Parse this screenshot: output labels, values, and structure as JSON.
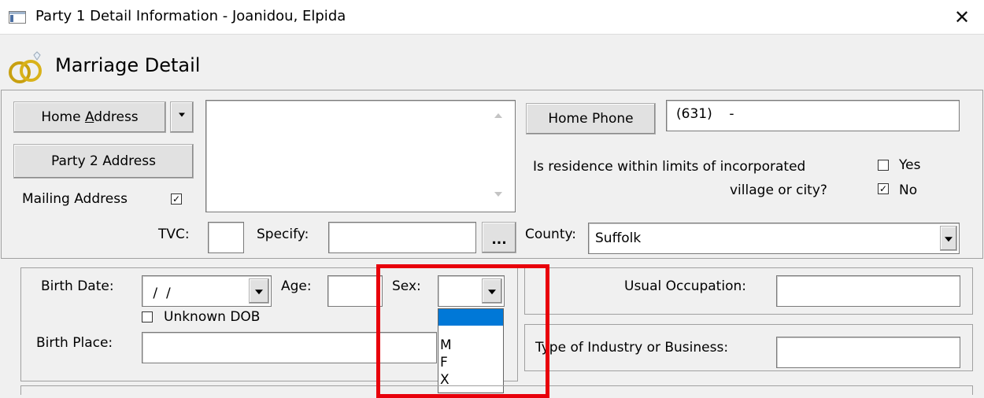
{
  "window": {
    "title": "Party 1 Detail Information - Joanidou, Elpida"
  },
  "header": {
    "title": "Marriage Detail"
  },
  "address": {
    "home_address_label": "Home Address",
    "home_address_accesskey": "A",
    "party2_address_label": "Party 2 Address",
    "mailing_address_label": "Mailing Address",
    "mailing_address_checked": "☑"
  },
  "phone": {
    "home_phone_label": "Home Phone",
    "home_phone_value": "(631)    -"
  },
  "residence": {
    "question_line1": "Is residence within limits of incorporated",
    "question_line2": "village or city?",
    "yes_label": "Yes",
    "no_label": "No",
    "no_check": "✓"
  },
  "location": {
    "tvc_label": "TVC:",
    "tvc_value": "",
    "specify_label": "Specify:",
    "specify_value": "",
    "ellipsis_label": "...",
    "county_label": "County:",
    "county_value": "Suffolk"
  },
  "person": {
    "birth_date_label": "Birth Date:",
    "birth_date_value": " /  /",
    "unknown_dob_label": "Unknown DOB",
    "age_label": "Age:",
    "age_value": "",
    "sex_label": "Sex:",
    "sex_value": "",
    "sex_options": [
      "",
      "M",
      "F",
      "X"
    ],
    "birth_place_label": "Birth Place:",
    "birth_place_value": ""
  },
  "occupation": {
    "usual_occupation_label": "Usual Occupation:",
    "industry_label": "Type of Industry or Business:"
  },
  "colors": {
    "highlight": "#e8000b",
    "selection": "#0078d7",
    "rings": "#c8a010"
  }
}
